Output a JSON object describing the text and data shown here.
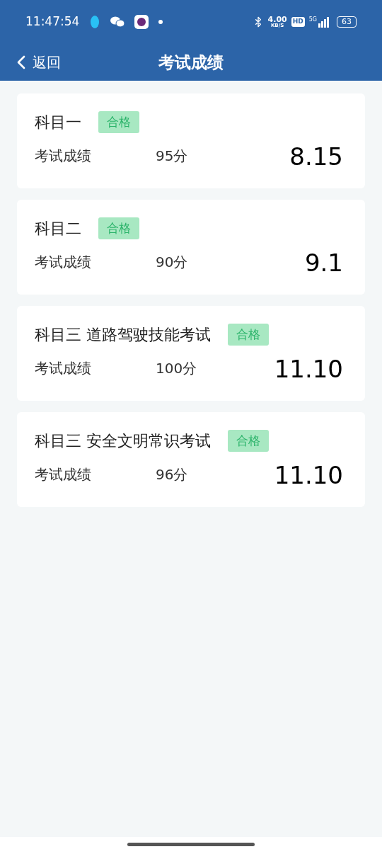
{
  "status_bar": {
    "time": "11:47:54",
    "speed_value": "4.00",
    "speed_unit": "KB/S",
    "hd": "HD",
    "network": "5G",
    "battery": "63"
  },
  "header": {
    "back": "返回",
    "title": "考试成绩"
  },
  "results": [
    {
      "subject": "科目一",
      "badge": "合格",
      "label": "考试成绩",
      "score": "95分",
      "date": "8.15"
    },
    {
      "subject": "科目二",
      "badge": "合格",
      "label": "考试成绩",
      "score": "90分",
      "date": "9.1"
    },
    {
      "subject": "科目三 道路驾驶技能考试",
      "badge": "合格",
      "label": "考试成绩",
      "score": "100分",
      "date": "11.10"
    },
    {
      "subject": "科目三 安全文明常识考试",
      "badge": "合格",
      "label": "考试成绩",
      "score": "96分",
      "date": "11.10"
    }
  ]
}
